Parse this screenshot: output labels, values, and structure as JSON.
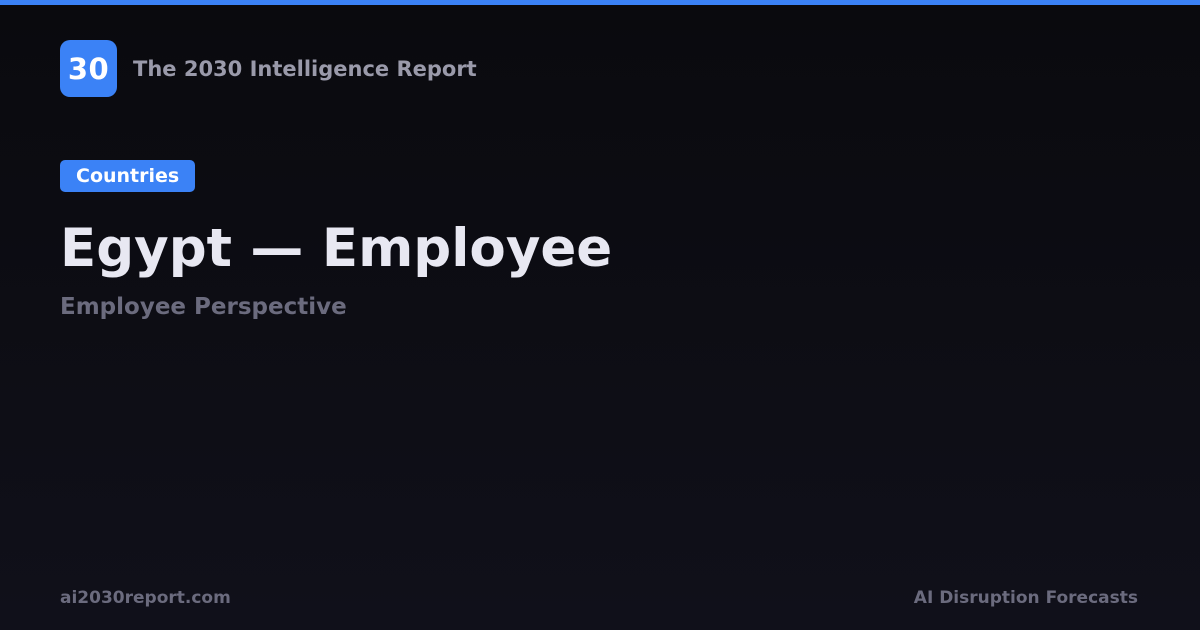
{
  "brand": {
    "logo_text": "30",
    "name": "The 2030 Intelligence Report"
  },
  "category": {
    "label": "Countries"
  },
  "page": {
    "title": "Egypt — Employee",
    "subtitle": "Employee Perspective"
  },
  "footer": {
    "site": "ai2030report.com",
    "tagline": "AI Disruption Forecasts"
  },
  "colors": {
    "accent": "#3b82f6",
    "background": "#0c0c12",
    "title": "#e8e8f2",
    "muted": "#6b6b7e"
  }
}
